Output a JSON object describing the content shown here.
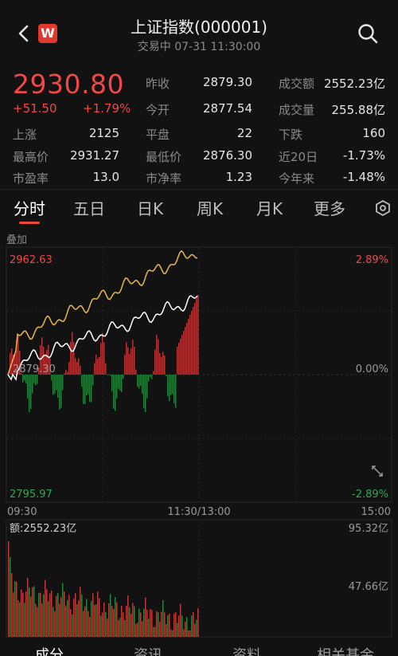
{
  "header": {
    "title": "上证指数(000001)",
    "subtitle": "交易中 07-31 11:30:00",
    "logo_text": "W",
    "icons": [
      "back-arrow-icon",
      "app-logo-icon",
      "search-icon"
    ]
  },
  "quote": {
    "price": "2930.80",
    "change": "+51.50",
    "change_pct": "+1.79%",
    "rows": [
      [
        {
          "label": "昨收",
          "value": "2879.30"
        },
        {
          "label": "成交额",
          "value": "2552.23亿"
        }
      ],
      [
        {
          "label": "今开",
          "value": "2877.54"
        },
        {
          "label": "成交量",
          "value": "255.88亿"
        }
      ]
    ],
    "grid": [
      [
        {
          "label": "上涨",
          "value": "2125"
        },
        {
          "label": "平盘",
          "value": "22"
        },
        {
          "label": "下跌",
          "value": "160"
        }
      ],
      [
        {
          "label": "最高价",
          "value": "2931.27"
        },
        {
          "label": "最低价",
          "value": "2876.30"
        },
        {
          "label": "近20日",
          "value": "-1.73%"
        }
      ],
      [
        {
          "label": "市盈率",
          "value": "13.0"
        },
        {
          "label": "市净率",
          "value": "1.23"
        },
        {
          "label": "今年来",
          "value": "-1.48%"
        }
      ]
    ]
  },
  "tabs": [
    "分时",
    "五日",
    "日K",
    "周K",
    "月K",
    "更多"
  ],
  "overlay_label": "叠加",
  "intraday": {
    "y_top": "2962.63",
    "y_mid": "2879.30",
    "y_bottom": "2795.97",
    "pct_top": "2.89%",
    "pct_mid": "0.00%",
    "pct_bottom": "-2.89%",
    "x_labels": [
      "09:30",
      "11:30/13:00",
      "15:00"
    ],
    "amount_label": "额:2552.23亿",
    "vol_top": "95.32亿",
    "vol_mid": "47.66亿",
    "colors": {
      "up": "#f04848",
      "down": "#2fa84f",
      "price_line": "#ffffff",
      "avg_line": "#e8b84a"
    }
  },
  "bottom_tabs": [
    "成分",
    "资讯",
    "资料",
    "相关基金"
  ],
  "colors": {
    "accent": "#e84a3c",
    "up": "#f04848",
    "down": "#2fa84f"
  }
}
